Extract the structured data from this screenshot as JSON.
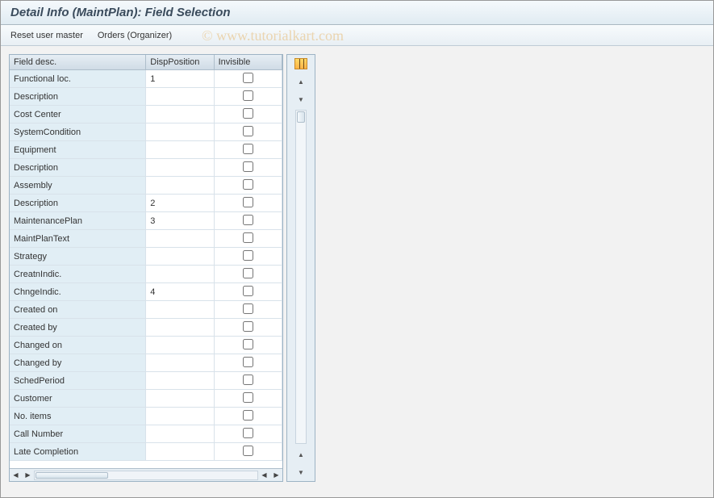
{
  "title": "Detail Info (MaintPlan): Field Selection",
  "toolbar": {
    "reset_user_master": "Reset user master",
    "orders_organizer": "Orders (Organizer)"
  },
  "watermark": "© www.tutorialkart.com",
  "columns": {
    "field_desc": "Field desc.",
    "disp_position": "DispPosition",
    "invisible": "Invisible"
  },
  "rows": [
    {
      "desc": "Functional loc.",
      "pos": "1",
      "inv": false
    },
    {
      "desc": "Description",
      "pos": "",
      "inv": false
    },
    {
      "desc": "Cost Center",
      "pos": "",
      "inv": false
    },
    {
      "desc": "SystemCondition",
      "pos": "",
      "inv": false
    },
    {
      "desc": "Equipment",
      "pos": "",
      "inv": false
    },
    {
      "desc": "Description",
      "pos": "",
      "inv": false
    },
    {
      "desc": "Assembly",
      "pos": "",
      "inv": false
    },
    {
      "desc": "Description",
      "pos": "2",
      "inv": false
    },
    {
      "desc": "MaintenancePlan",
      "pos": "3",
      "inv": false
    },
    {
      "desc": "MaintPlanText",
      "pos": "",
      "inv": false
    },
    {
      "desc": "Strategy",
      "pos": "",
      "inv": false
    },
    {
      "desc": "CreatnIndic.",
      "pos": "",
      "inv": false
    },
    {
      "desc": "ChngeIndic.",
      "pos": "4",
      "inv": false
    },
    {
      "desc": "Created on",
      "pos": "",
      "inv": false
    },
    {
      "desc": "Created by",
      "pos": "",
      "inv": false
    },
    {
      "desc": "Changed on",
      "pos": "",
      "inv": false
    },
    {
      "desc": "Changed by",
      "pos": "",
      "inv": false
    },
    {
      "desc": "SchedPeriod",
      "pos": "",
      "inv": false
    },
    {
      "desc": "Customer",
      "pos": "",
      "inv": false
    },
    {
      "desc": "No. items",
      "pos": "",
      "inv": false
    },
    {
      "desc": "Call Number",
      "pos": "",
      "inv": false
    },
    {
      "desc": "Late Completion",
      "pos": "",
      "inv": false
    }
  ]
}
